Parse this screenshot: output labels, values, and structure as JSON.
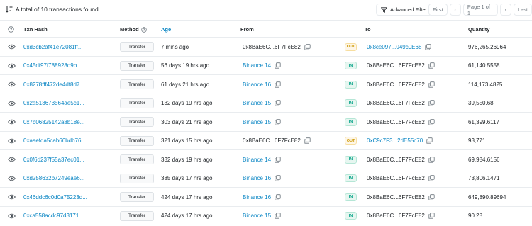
{
  "summary": {
    "text": "A total of 10 transactions found"
  },
  "toolbar": {
    "filter_label": "Advanced Filter",
    "first_label": "First",
    "page_label": "Page 1 of 1",
    "last_label": "Last"
  },
  "columns": {
    "txn_hash": "Txn Hash",
    "method": "Method",
    "age": "Age",
    "from": "From",
    "to": "To",
    "quantity": "Quantity"
  },
  "rows": [
    {
      "hash": "0xd3cb2af41e72081ff...",
      "method": "Transfer",
      "age": "7 mins ago",
      "from": "0x8BaE6C...6F7FcE82",
      "from_link": false,
      "dir": "OUT",
      "to": "0x8ce097...049c0E68",
      "to_link": true,
      "qty": "976,265.26964"
    },
    {
      "hash": "0x45df97f788928d9b...",
      "method": "Transfer",
      "age": "56 days 19 hrs ago",
      "from": "Binance 14",
      "from_link": true,
      "dir": "IN",
      "to": "0x8BaE6C...6F7FcE82",
      "to_link": false,
      "qty": "61,140.5558"
    },
    {
      "hash": "0x8278fff472de4df8d7...",
      "method": "Transfer",
      "age": "61 days 21 hrs ago",
      "from": "Binance 16",
      "from_link": true,
      "dir": "IN",
      "to": "0x8BaE6C...6F7FcE82",
      "to_link": false,
      "qty": "114,173.4825"
    },
    {
      "hash": "0x2a513673564ae5c1...",
      "method": "Transfer",
      "age": "132 days 19 hrs ago",
      "from": "Binance 15",
      "from_link": true,
      "dir": "IN",
      "to": "0x8BaE6C...6F7FcE82",
      "to_link": false,
      "qty": "39,550.68"
    },
    {
      "hash": "0x7b06825142a8b18e...",
      "method": "Transfer",
      "age": "303 days 21 hrs ago",
      "from": "Binance 15",
      "from_link": true,
      "dir": "IN",
      "to": "0x8BaE6C...6F7FcE82",
      "to_link": false,
      "qty": "61,399.6117"
    },
    {
      "hash": "0xaaefda5cab66bdb76...",
      "method": "Transfer",
      "age": "321 days 15 hrs ago",
      "from": "0x8BaE6C...6F7FcE82",
      "from_link": false,
      "dir": "OUT",
      "to": "0xC9c7F3...2dE55c70",
      "to_link": true,
      "qty": "93,771"
    },
    {
      "hash": "0x0f6d237f55a37ec01...",
      "method": "Transfer",
      "age": "332 days 19 hrs ago",
      "from": "Binance 14",
      "from_link": true,
      "dir": "IN",
      "to": "0x8BaE6C...6F7FcE82",
      "to_link": false,
      "qty": "69,984.6156"
    },
    {
      "hash": "0xd258632b7249eae6...",
      "method": "Transfer",
      "age": "385 days 17 hrs ago",
      "from": "Binance 16",
      "from_link": true,
      "dir": "IN",
      "to": "0x8BaE6C...6F7FcE82",
      "to_link": false,
      "qty": "73,806.1471"
    },
    {
      "hash": "0x46ddc6c0d0a75223d...",
      "method": "Transfer",
      "age": "424 days 17 hrs ago",
      "from": "Binance 16",
      "from_link": true,
      "dir": "IN",
      "to": "0x8BaE6C...6F7FcE82",
      "to_link": false,
      "qty": "649,890.89694"
    },
    {
      "hash": "0xca558acdc97d3171...",
      "method": "Transfer",
      "age": "424 days 17 hrs ago",
      "from": "Binance 15",
      "from_link": true,
      "dir": "IN",
      "to": "0x8BaE6C...6F7FcE82",
      "to_link": false,
      "qty": "90.28"
    }
  ]
}
